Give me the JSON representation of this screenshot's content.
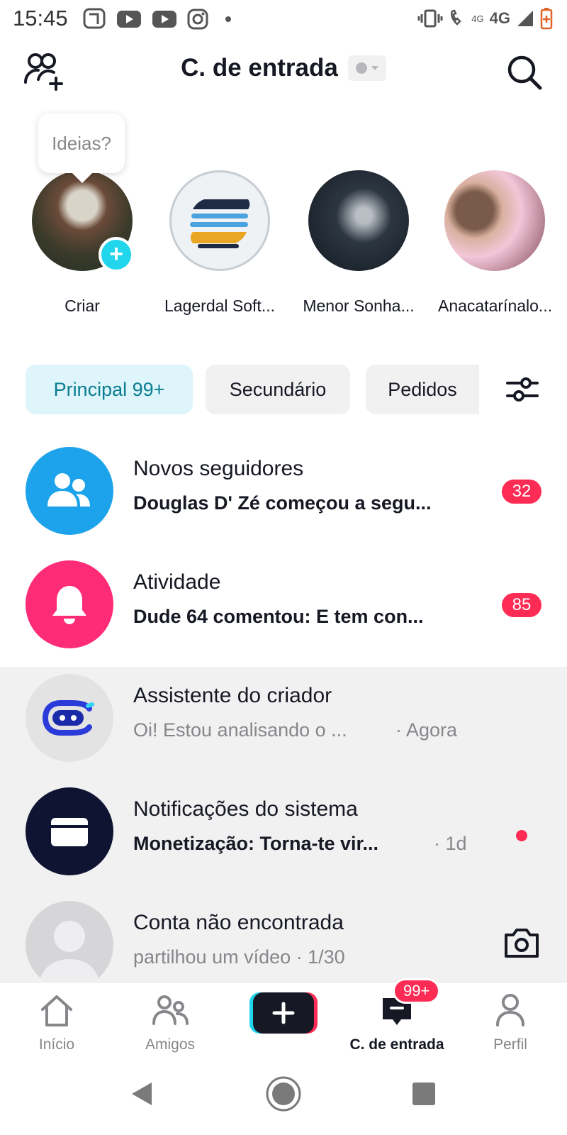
{
  "status_bar": {
    "time": "15:45",
    "network_small": "4G",
    "network": "4G",
    "colors": {
      "battery": "#e0632a"
    }
  },
  "header": {
    "title": "C. de entrada",
    "icons": {
      "left": "add-friends-icon",
      "right": "search-icon"
    }
  },
  "stories": {
    "tooltip": "Ideias?",
    "items": [
      {
        "name": "Criar"
      },
      {
        "name": "Lagerdal Soft..."
      },
      {
        "name": "Menor Sonha..."
      },
      {
        "name": "Anacatarínalo..."
      }
    ]
  },
  "filters": {
    "chips": [
      {
        "label": "Principal 99+",
        "active": true
      },
      {
        "label": "Secundário",
        "active": false
      },
      {
        "label": "Pedidos",
        "active": false
      }
    ],
    "settings_icon": "sliders-icon"
  },
  "inbox": [
    {
      "title": "Novos seguidores",
      "subtitle": "Douglas D' Zé começou a segu...",
      "badge": "32",
      "icon": "followers-icon",
      "color": "#1ca3ec"
    },
    {
      "title": "Atividade",
      "subtitle": "Dude 64 comentou: E tem con...",
      "badge": "85",
      "icon": "bell-icon",
      "color": "#fe2c76"
    },
    {
      "title": "Assistente do criador",
      "subtitle": "Oi! Estou analisando o ...",
      "time": "· Agora",
      "icon": "assistant-icon",
      "color": "#e3e3e4"
    },
    {
      "title": "Notificações do sistema",
      "subtitle": "Monetização: Torna-te vir...",
      "time": "· 1d",
      "icon": "inbox-tray-icon",
      "color": "#0f1433"
    },
    {
      "title": "Conta não encontrada",
      "subtitle": "partilhou um vídeo · 1/30",
      "icon": "default-avatar-icon",
      "color": "#d6d6d8"
    }
  ],
  "bottom_nav": {
    "items": [
      {
        "label": "Início",
        "icon": "home-icon"
      },
      {
        "label": "Amigos",
        "icon": "friends-icon"
      },
      {
        "label": "",
        "icon": "plus-icon"
      },
      {
        "label": "C. de entrada",
        "icon": "inbox-icon",
        "badge": "99+"
      },
      {
        "label": "Perfil",
        "icon": "profile-icon"
      }
    ]
  },
  "colors": {
    "accent_red": "#fe2c55",
    "accent_cyan": "#20d5ec",
    "chip_active_bg": "#def5fb",
    "chip_active_text": "#0b7d91"
  }
}
